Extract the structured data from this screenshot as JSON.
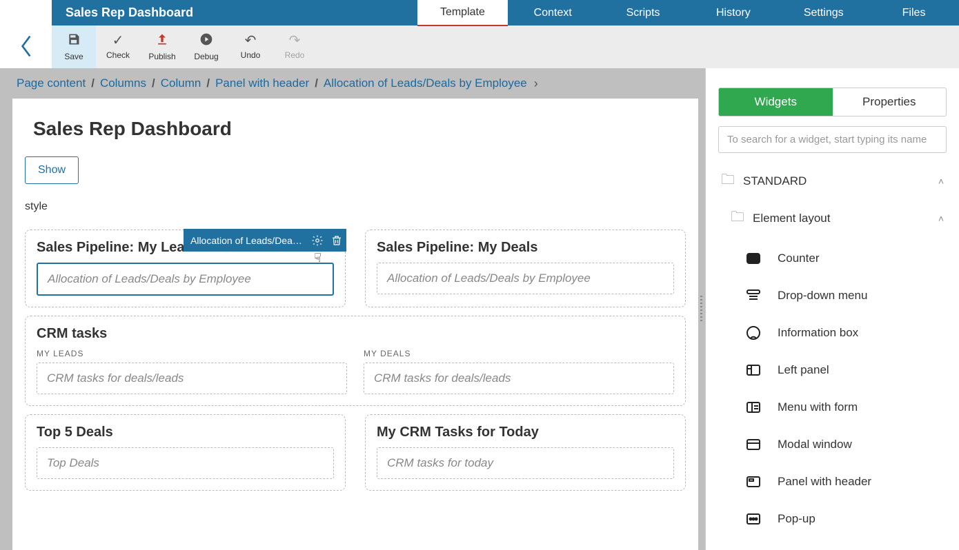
{
  "header": {
    "title": "Sales Rep Dashboard",
    "tabs": [
      "Template",
      "Context",
      "Scripts",
      "History",
      "Settings",
      "Files"
    ],
    "active_tab": "Template"
  },
  "toolbar": {
    "save": "Save",
    "check": "Check",
    "publish": "Publish",
    "debug": "Debug",
    "undo": "Undo",
    "redo": "Redo"
  },
  "breadcrumb": {
    "items": [
      "Page content",
      "Columns",
      "Column",
      "Panel with header",
      "Allocation of Leads/Deals by Employee"
    ]
  },
  "page": {
    "title": "Sales Rep Dashboard",
    "show_button": "Show",
    "style_label": "style"
  },
  "panels": {
    "leads": {
      "title": "Sales Pipeline: My Leads",
      "slot": "Allocation of Leads/Deals by Employee",
      "badge": "Allocation of Leads/Deals b..."
    },
    "deals": {
      "title": "Sales Pipeline: My Deals",
      "slot": "Allocation of Leads/Deals by Employee"
    },
    "crm": {
      "title": "CRM tasks",
      "left_label": "MY LEADS",
      "right_label": "MY DEALS",
      "left_slot": "CRM tasks for deals/leads",
      "right_slot": "CRM tasks for deals/leads"
    },
    "top5": {
      "title": "Top 5 Deals",
      "slot": "Top Deals"
    },
    "today": {
      "title": "My CRM Tasks for Today",
      "slot": "CRM tasks for today"
    }
  },
  "right_pane": {
    "tabs": {
      "widgets": "Widgets",
      "properties": "Properties"
    },
    "search_placeholder": "To search for a widget, start typing its name",
    "sections": {
      "standard": "STANDARD",
      "element_layout": "Element layout"
    },
    "widgets": [
      "Counter",
      "Drop-down menu",
      "Information box",
      "Left panel",
      "Menu with form",
      "Modal window",
      "Panel with header",
      "Pop-up"
    ]
  }
}
